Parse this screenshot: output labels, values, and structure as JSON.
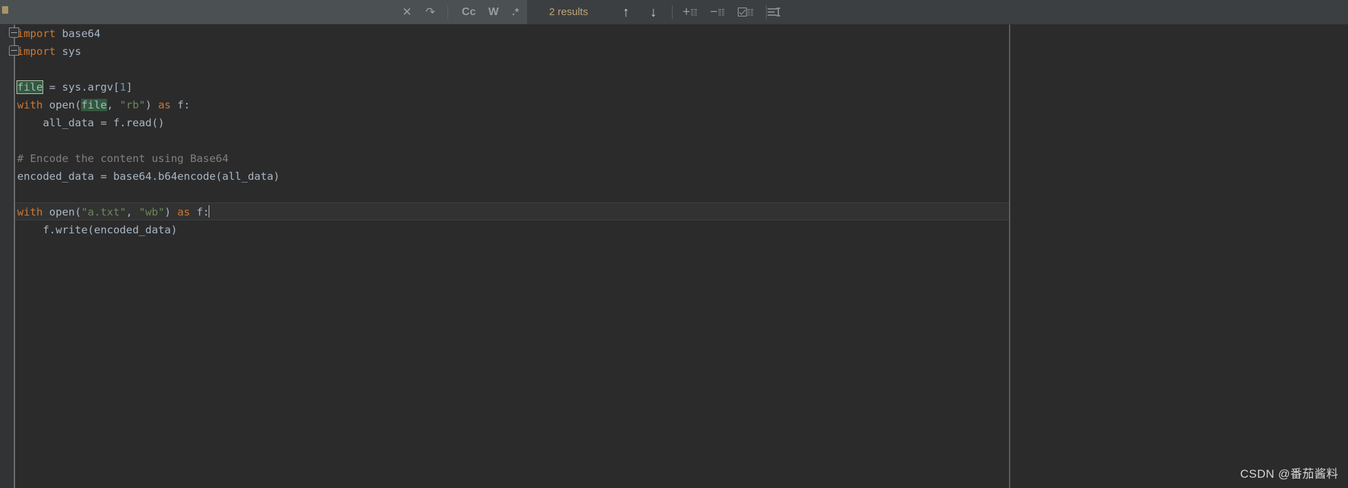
{
  "find_toolbar": {
    "search_value": "",
    "search_placeholder": "",
    "close_icon": "close-icon",
    "newline_icon": "newline-icon",
    "match_case_label": "Cc",
    "words_label": "W",
    "regex_label": ".*",
    "results_text": "2 results",
    "prev_icon": "arrow-up-icon",
    "next_icon": "arrow-down-icon",
    "add_occurrence_icon": "add-selection-icon",
    "remove_occurrence_icon": "remove-selection-icon",
    "select_all_occurrences_icon": "select-all-occurrences-icon",
    "filter_icon": "filter-lines-icon"
  },
  "editor": {
    "lines": [
      {
        "num": 1,
        "indent": 0,
        "tokens": [
          {
            "t": "import ",
            "c": "kw"
          },
          {
            "t": "base64",
            "c": "ident"
          }
        ]
      },
      {
        "num": 2,
        "indent": 0,
        "tokens": [
          {
            "t": "import ",
            "c": "kw"
          },
          {
            "t": "sys",
            "c": "ident"
          }
        ]
      },
      {
        "num": 3,
        "indent": 0,
        "tokens": []
      },
      {
        "num": 4,
        "indent": 0,
        "tokens": [
          {
            "t": "file",
            "c": "hl-current"
          },
          {
            "t": " = sys.argv[",
            "c": "ident"
          },
          {
            "t": "1",
            "c": "num"
          },
          {
            "t": "]",
            "c": "ident"
          }
        ]
      },
      {
        "num": 5,
        "indent": 0,
        "tokens": [
          {
            "t": "with ",
            "c": "kw"
          },
          {
            "t": "open(",
            "c": "ident"
          },
          {
            "t": "file",
            "c": "hl"
          },
          {
            "t": ", ",
            "c": "ident"
          },
          {
            "t": "\"rb\"",
            "c": "str"
          },
          {
            "t": ") ",
            "c": "ident"
          },
          {
            "t": "as ",
            "c": "kw"
          },
          {
            "t": "f:",
            "c": "ident"
          }
        ]
      },
      {
        "num": 6,
        "indent": 1,
        "tokens": [
          {
            "t": "all_data = f.read()",
            "c": "ident"
          }
        ]
      },
      {
        "num": 7,
        "indent": 0,
        "tokens": []
      },
      {
        "num": 8,
        "indent": 0,
        "tokens": [
          {
            "t": "# Encode the content using Base64",
            "c": "cmt"
          }
        ]
      },
      {
        "num": 9,
        "indent": 0,
        "tokens": [
          {
            "t": "encoded_data = base64.b64encode(all_data)",
            "c": "ident"
          }
        ]
      },
      {
        "num": 10,
        "indent": 0,
        "tokens": []
      },
      {
        "num": 11,
        "indent": 0,
        "caret_line": true,
        "tokens": [
          {
            "t": "with ",
            "c": "kw"
          },
          {
            "t": "open(",
            "c": "ident"
          },
          {
            "t": "\"a.txt\"",
            "c": "str"
          },
          {
            "t": ", ",
            "c": "ident"
          },
          {
            "t": "\"wb\"",
            "c": "str"
          },
          {
            "t": ") ",
            "c": "ident"
          },
          {
            "t": "as ",
            "c": "kw"
          },
          {
            "t": "f:",
            "c": "ident"
          },
          {
            "t": "",
            "c": "caret"
          }
        ]
      },
      {
        "num": 12,
        "indent": 1,
        "tokens": [
          {
            "t": "f.write(encoded_data)",
            "c": "ident"
          }
        ]
      }
    ]
  },
  "watermark": {
    "text": "CSDN @番茄酱料"
  },
  "colors": {
    "editor_background": "#2b2b2b",
    "toolbar_background": "#3c3f41",
    "search_field_background": "#4b5052",
    "gutter_background": "#313335",
    "keyword": "#cc7832",
    "string": "#6a8759",
    "number": "#6897bb",
    "comment": "#808080",
    "identifier": "#a9b7c6",
    "match_highlight": "#32593d",
    "results_text": "#c0a678",
    "caret_row": "#323232"
  }
}
